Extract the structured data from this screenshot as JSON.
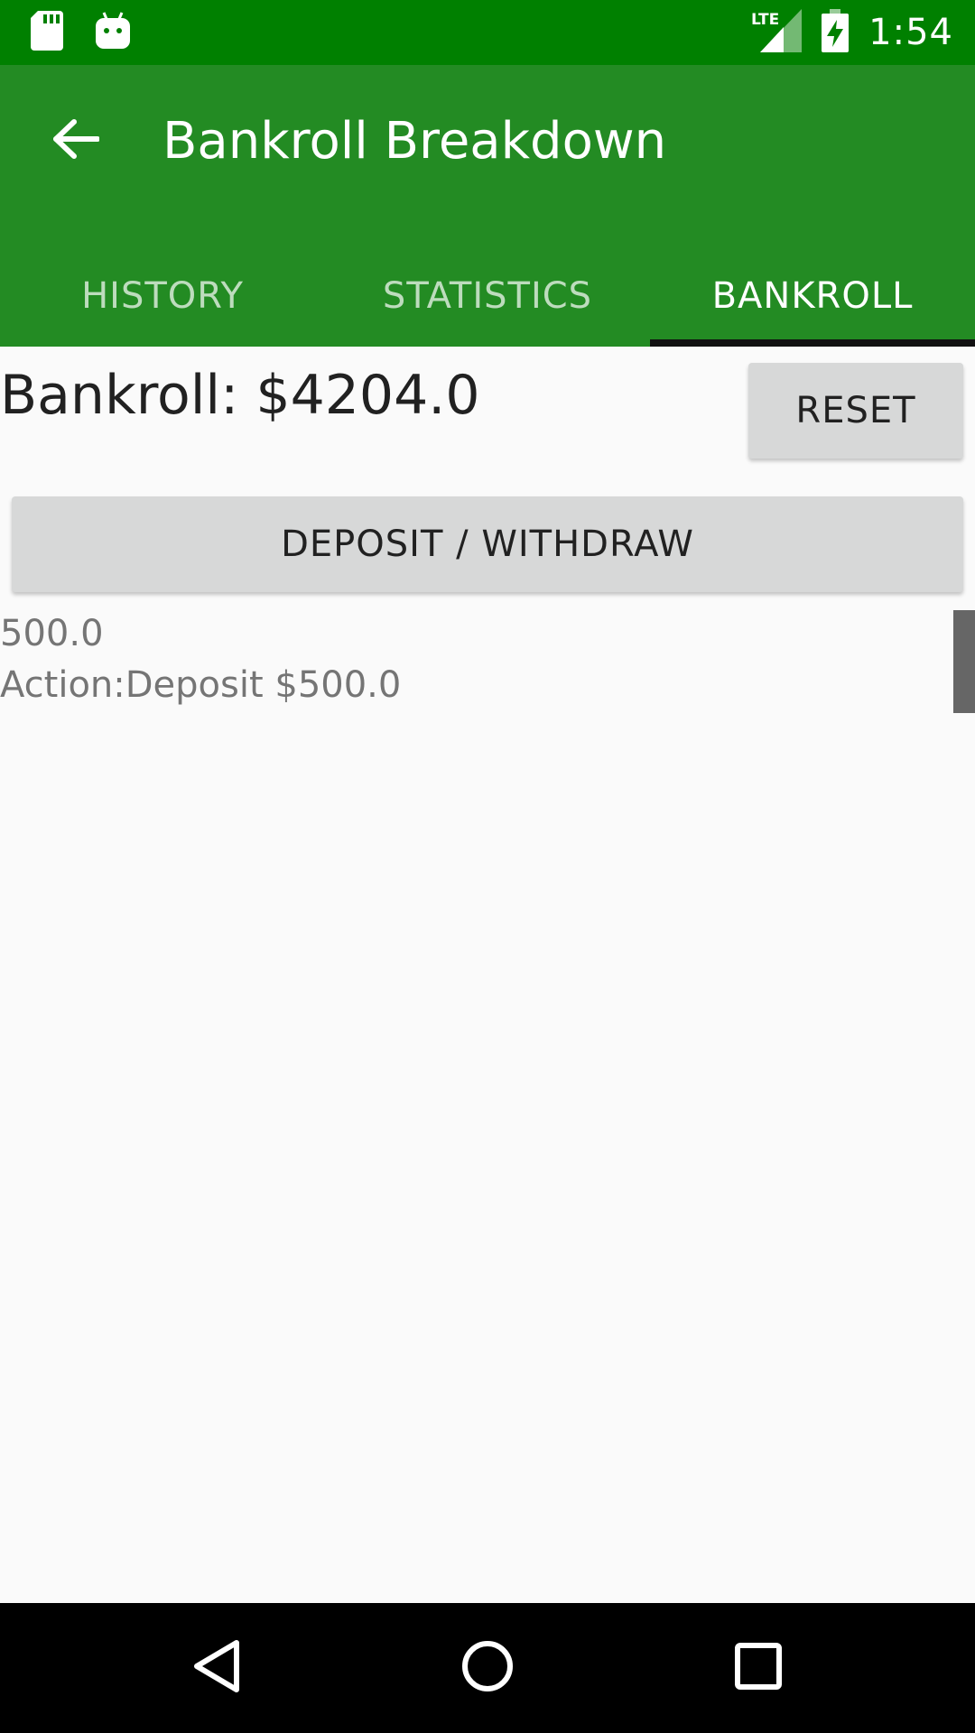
{
  "status_bar": {
    "time": "1:54",
    "network": "LTE",
    "icons": [
      "sd-card-icon",
      "android-icon",
      "lte-signal-icon",
      "battery-charging-icon"
    ]
  },
  "app_bar": {
    "title": "Bankroll Breakdown",
    "back_icon": "arrow-back-icon"
  },
  "tabs": [
    {
      "label": "HISTORY",
      "active": false
    },
    {
      "label": "STATISTICS",
      "active": false
    },
    {
      "label": "BANKROLL",
      "active": true
    }
  ],
  "main": {
    "bankroll_text": "Bankroll: $4204.0",
    "reset_label": "RESET",
    "deposit_withdraw_label": "DEPOSIT / WITHDRAW",
    "entries": [
      {
        "amount": "500.0",
        "action": "Action:Deposit $500.0"
      }
    ]
  },
  "nav_bar": {
    "icons": [
      "back-triangle-icon",
      "home-circle-icon",
      "recents-square-icon"
    ]
  },
  "colors": {
    "status_bar": "#008000",
    "app_bar": "#238b23",
    "background": "#fafafa",
    "button": "#d7d8d8",
    "tab_indicator": "#111111"
  }
}
